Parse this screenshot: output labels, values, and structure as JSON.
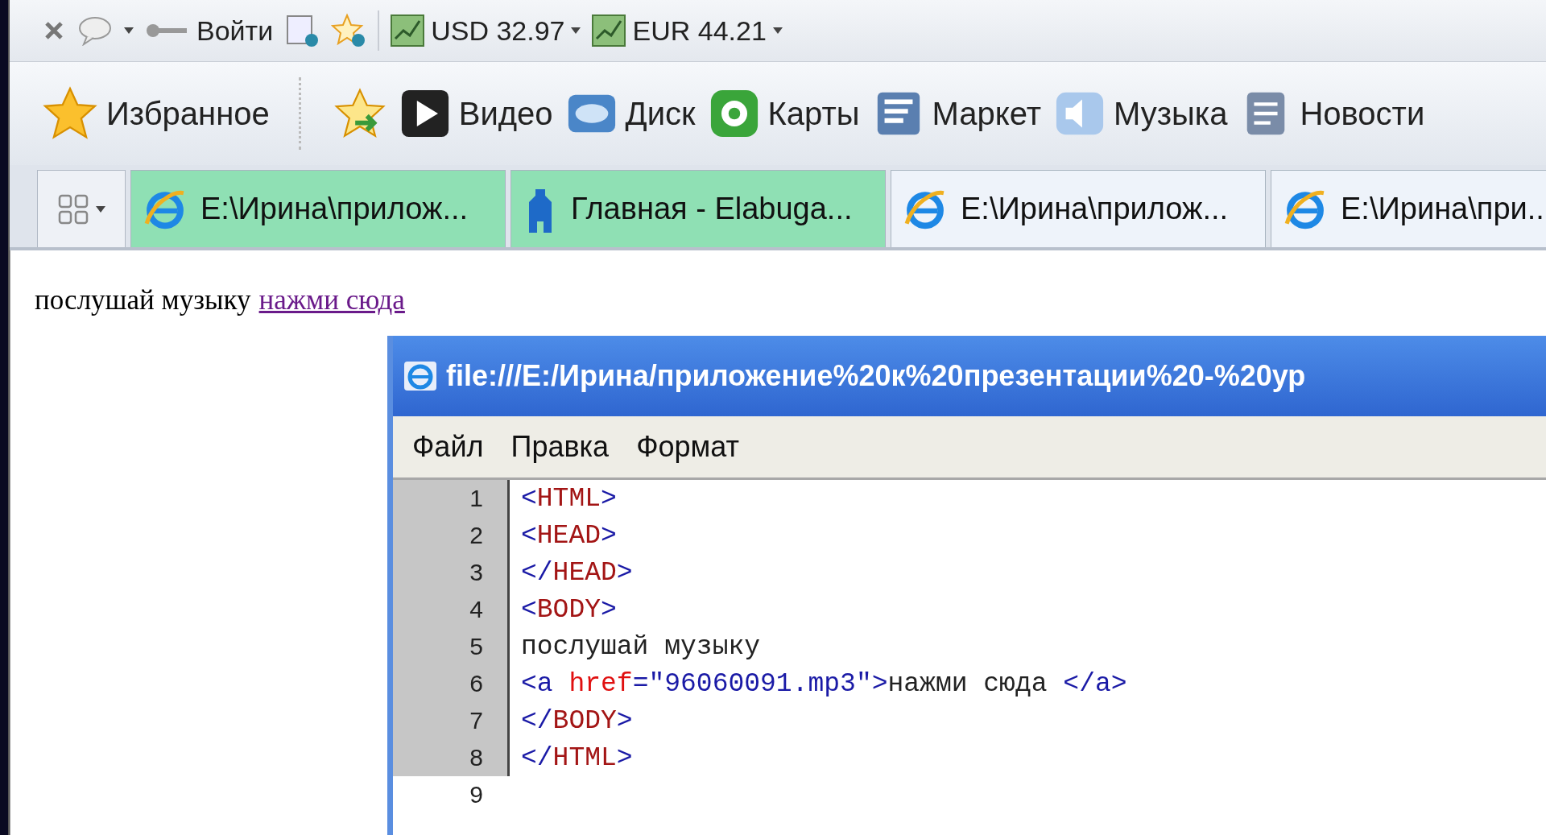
{
  "toolbar": {
    "login": "Войти",
    "rates": [
      {
        "label": "USD 32.97"
      },
      {
        "label": "EUR 44.21"
      }
    ]
  },
  "links_bar": {
    "favorites": "Избранное",
    "links": [
      {
        "label": "Видео",
        "kind": "video"
      },
      {
        "label": "Диск",
        "kind": "disk"
      },
      {
        "label": "Карты",
        "kind": "maps"
      },
      {
        "label": "Маркет",
        "kind": "market"
      },
      {
        "label": "Музыка",
        "kind": "music"
      },
      {
        "label": "Новости",
        "kind": "news"
      }
    ]
  },
  "tabs": [
    {
      "title": "E:\\Ирина\\прилож...",
      "kind": "ie",
      "highlighted": true
    },
    {
      "title": "Главная - Elabuga...",
      "kind": "site",
      "highlighted": true
    },
    {
      "title": "E:\\Ирина\\прилож...",
      "kind": "ie",
      "highlighted": false
    },
    {
      "title": "E:\\Ирина\\при...",
      "kind": "ie",
      "highlighted": false
    }
  ],
  "page": {
    "text": "послушай музыку",
    "link": "нажми сюда"
  },
  "source_window": {
    "title": "file:///E:/Ирина/приложение%20к%20презентации%20-%20ур",
    "menu": [
      "Файл",
      "Правка",
      "Формат"
    ],
    "lines": [
      {
        "number": "1",
        "selected": true,
        "tokens": [
          {
            "kind": "punct",
            "text": "<"
          },
          {
            "kind": "tag",
            "text": "HTML"
          },
          {
            "kind": "punct",
            "text": ">"
          }
        ]
      },
      {
        "number": "2",
        "selected": true,
        "tokens": [
          {
            "kind": "punct",
            "text": "<"
          },
          {
            "kind": "tag",
            "text": "HEAD"
          },
          {
            "kind": "punct",
            "text": ">"
          }
        ]
      },
      {
        "number": "3",
        "selected": true,
        "tokens": [
          {
            "kind": "punct",
            "text": "</"
          },
          {
            "kind": "tag",
            "text": "HEAD"
          },
          {
            "kind": "punct",
            "text": ">"
          }
        ]
      },
      {
        "number": "4",
        "selected": true,
        "tokens": [
          {
            "kind": "punct",
            "text": "<"
          },
          {
            "kind": "tag",
            "text": "BODY"
          },
          {
            "kind": "punct",
            "text": ">"
          }
        ]
      },
      {
        "number": "5",
        "selected": true,
        "tokens": [
          {
            "kind": "text",
            "text": "послушай музыку"
          }
        ]
      },
      {
        "number": "6",
        "selected": true,
        "tokens": [
          {
            "kind": "punct",
            "text": "<a "
          },
          {
            "kind": "attr",
            "text": "href"
          },
          {
            "kind": "punct",
            "text": "=\"96060091.mp3\">"
          },
          {
            "kind": "text",
            "text": "нажми сюда "
          },
          {
            "kind": "punct",
            "text": "</a>"
          }
        ]
      },
      {
        "number": "7",
        "selected": true,
        "tokens": [
          {
            "kind": "punct",
            "text": "</"
          },
          {
            "kind": "tag",
            "text": "BODY"
          },
          {
            "kind": "punct",
            "text": ">"
          }
        ]
      },
      {
        "number": "8",
        "selected": true,
        "tokens": [
          {
            "kind": "punct",
            "text": "</"
          },
          {
            "kind": "tag",
            "text": "HTML"
          },
          {
            "kind": "punct",
            "text": ">"
          }
        ]
      },
      {
        "number": "9",
        "selected": false
      }
    ]
  }
}
